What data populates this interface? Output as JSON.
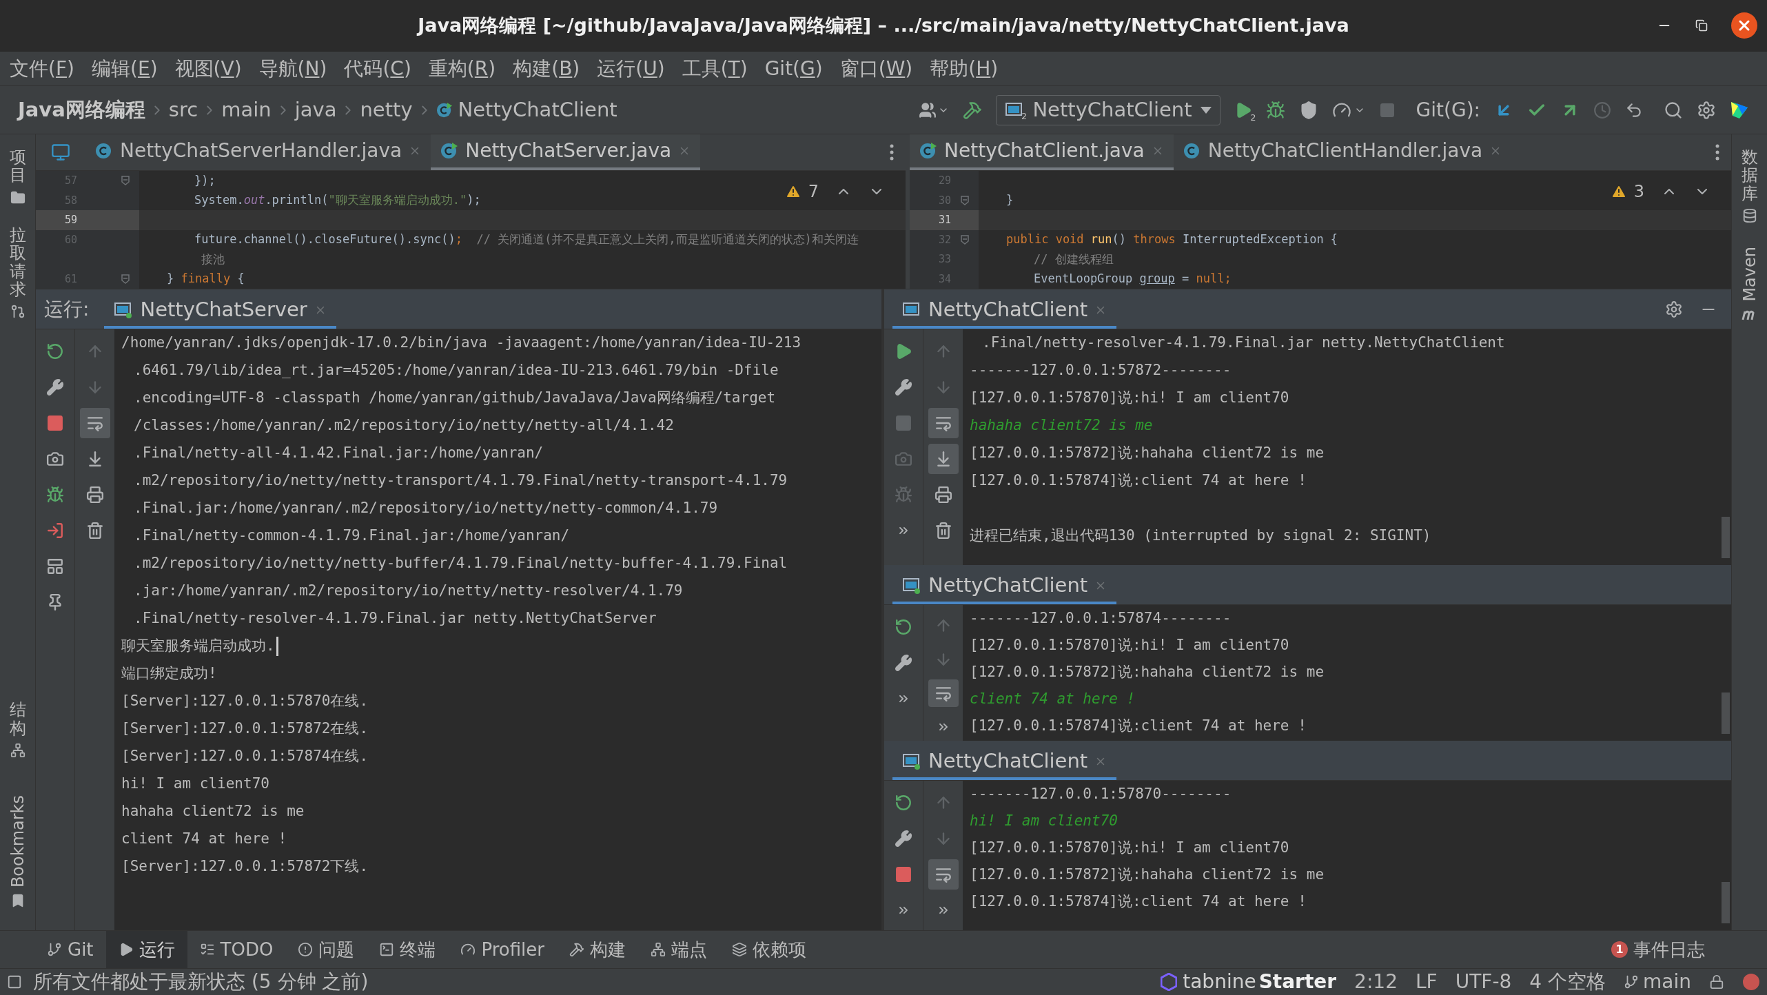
{
  "window": {
    "title": "Java网络编程 [~/github/JavaJava/Java网络编程] – .../src/main/java/netty/NettyChatClient.java"
  },
  "menu": [
    {
      "before": "文件(",
      "key": "F",
      "after": ")"
    },
    {
      "before": "编辑(",
      "key": "E",
      "after": ")"
    },
    {
      "before": "视图(",
      "key": "V",
      "after": ")"
    },
    {
      "before": "导航(",
      "key": "N",
      "after": ")"
    },
    {
      "before": "代码(",
      "key": "C",
      "after": ")"
    },
    {
      "before": "重构(",
      "key": "R",
      "after": ")"
    },
    {
      "before": "构建(",
      "key": "B",
      "after": ")"
    },
    {
      "before": "运行(",
      "key": "U",
      "after": ")"
    },
    {
      "before": "工具(",
      "key": "T",
      "after": ")"
    },
    {
      "before": "Git(",
      "key": "G",
      "after": ")"
    },
    {
      "before": "窗口(",
      "key": "W",
      "after": ")"
    },
    {
      "before": "帮助(",
      "key": "H",
      "after": ")"
    }
  ],
  "breadcrumbs": [
    {
      "label": "Java网络编程",
      "kind": "project"
    },
    {
      "label": "src",
      "kind": "folder"
    },
    {
      "label": "main",
      "kind": "folder"
    },
    {
      "label": "java",
      "kind": "folder"
    },
    {
      "label": "netty",
      "kind": "folder"
    },
    {
      "label": "NettyChatClient",
      "kind": "class"
    }
  ],
  "toolbar": {
    "run_config": "NettyChatClient",
    "config_badge": "2",
    "run_badge": "2",
    "git_label": "Git(G):"
  },
  "left_strip": {
    "top": [
      {
        "label": "项目",
        "kind": "project"
      },
      {
        "label": "拉取请求",
        "kind": "pull"
      }
    ],
    "bottom": [
      {
        "label": "结构",
        "kind": "structure"
      },
      {
        "label": "Bookmarks",
        "kind": "bookmarks"
      }
    ]
  },
  "right_strip": [
    {
      "label": "数据库",
      "kind": "database"
    },
    {
      "label": "Maven",
      "kind": "maven"
    }
  ],
  "editors": [
    {
      "tabs": [
        {
          "label": "NettyChatServerHandler.java",
          "selected": false,
          "runnable": false
        },
        {
          "label": "NettyChatServer.java",
          "selected": true,
          "runnable": true
        }
      ],
      "warnings": "7",
      "lines": [
        {
          "number": "57",
          "current": false,
          "fold": true,
          "kind": "inner",
          "segments": [
            {
              "text": "});",
              "kind": "plain"
            }
          ]
        },
        {
          "number": "58",
          "current": false,
          "fold": false,
          "kind": "inner",
          "segments": [
            {
              "text": "System.",
              "kind": "plain"
            },
            {
              "text": "out",
              "kind": "field"
            },
            {
              "text": ".println(",
              "kind": "plain"
            },
            {
              "text": "\"聊天室服务端启动成功.\"",
              "kind": "string"
            },
            {
              "text": ");",
              "kind": "plain"
            }
          ]
        },
        {
          "number": "59",
          "current": true,
          "fold": false
        },
        {
          "number": "60",
          "current": false,
          "fold": false,
          "kind": "inner",
          "segments": [
            {
              "text": "future.channel().closeFuture().sync()",
              "kind": "plain"
            },
            {
              "text": ";",
              "kind": "keyword"
            },
            {
              "text": "  // 关闭通道(并不是真正意义上关闭,而是监听通道关闭的状态)和关闭连",
              "kind": "comment"
            }
          ]
        },
        {
          "current": false,
          "fold": false,
          "kind": "wrapped",
          "segments": [
            {
              "text": "接池",
              "kind": "comment"
            }
          ]
        },
        {
          "number": "61",
          "current": false,
          "fold": true,
          "kind": "outer",
          "segments": [
            {
              "text": "} ",
              "kind": "plain"
            },
            {
              "text": "finally",
              "kind": "keyword"
            },
            {
              "text": " {",
              "kind": "plain"
            }
          ]
        }
      ]
    },
    {
      "tabs": [
        {
          "label": "NettyChatClient.java",
          "selected": true,
          "runnable": true
        },
        {
          "label": "NettyChatClientHandler.java",
          "selected": false,
          "runnable": false
        }
      ],
      "warnings": "3",
      "lines": [
        {
          "number": "29",
          "current": false,
          "fold": false
        },
        {
          "number": "30",
          "current": false,
          "fold": true,
          "kind": "outer",
          "segments": [
            {
              "text": "}",
              "kind": "plain"
            }
          ]
        },
        {
          "number": "31",
          "current": true,
          "fold": false
        },
        {
          "number": "32",
          "current": false,
          "fold": true,
          "kind": "outer",
          "segments": [
            {
              "text": "public void",
              "kind": "keyword"
            },
            {
              "text": " run",
              "kind": "method"
            },
            {
              "text": "() ",
              "kind": "plain"
            },
            {
              "text": "throws",
              "kind": "keyword"
            },
            {
              "text": " InterruptedException {",
              "kind": "plain"
            }
          ]
        },
        {
          "number": "33",
          "current": false,
          "fold": false,
          "kind": "inner",
          "segments": [
            {
              "text": "// 创建线程组",
              "kind": "comment"
            }
          ]
        },
        {
          "number": "34",
          "current": false,
          "fold": false,
          "kind": "inner",
          "segments": [
            {
              "text": "EventLoopGroup ",
              "kind": "plain"
            },
            {
              "text": "group",
              "kind": "underline"
            },
            {
              "text": " = ",
              "kind": "plain"
            },
            {
              "text": "null",
              "kind": "keyword"
            },
            {
              "text": ";",
              "kind": "keyword"
            }
          ]
        }
      ]
    }
  ],
  "run": {
    "label": "运行:",
    "panels": [
      {
        "title": "NettyChatServer",
        "running": true,
        "selected": true,
        "tools_a": [
          {
            "kind": "rerun",
            "disabled": false
          },
          {
            "kind": "wrench",
            "disabled": false
          },
          {
            "kind": "stop",
            "disabled": false
          },
          {
            "kind": "camera",
            "disabled": false
          },
          {
            "kind": "debug",
            "disabled": false
          },
          {
            "kind": "exit",
            "disabled": false
          },
          {
            "kind": "layout",
            "disabled": false
          },
          {
            "kind": "pin",
            "disabled": false
          }
        ],
        "tools_b": [
          {
            "kind": "up",
            "disabled": true,
            "selected": false
          },
          {
            "kind": "down",
            "disabled": true,
            "selected": false
          },
          {
            "kind": "wrap",
            "disabled": false,
            "selected": true
          },
          {
            "kind": "scroll-end",
            "disabled": false,
            "selected": false
          },
          {
            "kind": "print",
            "disabled": false,
            "selected": false
          },
          {
            "kind": "trash",
            "disabled": false,
            "selected": false
          }
        ],
        "lines": [
          {
            "kind": "output",
            "text": "/home/yanran/.jdks/openjdk-17.0.2/bin/java -javaagent:/home/yanran/idea-IU-213"
          },
          {
            "kind": "cont",
            "text": ".6461.79/lib/idea_rt.jar=45205:/home/yanran/idea-IU-213.6461.79/bin -Dfile"
          },
          {
            "kind": "cont",
            "text": ".encoding=UTF-8 -classpath /home/yanran/github/JavaJava/Java网络编程/target"
          },
          {
            "kind": "cont",
            "text": "/classes:/home/yanran/.m2/repository/io/netty/netty-all/4.1.42"
          },
          {
            "kind": "cont",
            "text": ".Final/netty-all-4.1.42.Final.jar:/home/yanran/"
          },
          {
            "kind": "cont",
            "text": ".m2/repository/io/netty/netty-transport/4.1.79.Final/netty-transport-4.1.79"
          },
          {
            "kind": "cont",
            "text": ".Final.jar:/home/yanran/.m2/repository/io/netty/netty-common/4.1.79"
          },
          {
            "kind": "cont",
            "text": ".Final/netty-common-4.1.79.Final.jar:/home/yanran/"
          },
          {
            "kind": "cont",
            "text": ".m2/repository/io/netty/netty-buffer/4.1.79.Final/netty-buffer-4.1.79.Final"
          },
          {
            "kind": "cont",
            "text": ".jar:/home/yanran/.m2/repository/io/netty/netty-resolver/4.1.79"
          },
          {
            "kind": "cont",
            "text": ".Final/netty-resolver-4.1.79.Final.jar netty.NettyChatServer"
          },
          {
            "kind": "caret",
            "text": "聊天室服务端启动成功."
          },
          {
            "kind": "output",
            "text": "端口绑定成功!"
          },
          {
            "kind": "output",
            "text": "[Server]:127.0.0.1:57870在线."
          },
          {
            "kind": "output",
            "text": "[Server]:127.0.0.1:57872在线."
          },
          {
            "kind": "output",
            "text": "[Server]:127.0.0.1:57874在线."
          },
          {
            "kind": "output",
            "text": "hi! I am client70"
          },
          {
            "kind": "output",
            "text": "hahaha client72 is me"
          },
          {
            "kind": "output",
            "text": "client 74 at here !"
          },
          {
            "kind": "output",
            "text": "[Server]:127.0.0.1:57872下线."
          }
        ]
      },
      {
        "title": "NettyChatClient",
        "running": false,
        "selected": true,
        "tools_a": [
          {
            "kind": "run",
            "disabled": false
          },
          {
            "kind": "wrench",
            "disabled": false
          },
          {
            "kind": "stop",
            "disabled": true
          },
          {
            "kind": "camera",
            "disabled": true
          },
          {
            "kind": "debug",
            "disabled": true
          },
          {
            "kind": "more",
            "disabled": false
          }
        ],
        "tools_b": [
          {
            "kind": "up",
            "disabled": true,
            "selected": false
          },
          {
            "kind": "down",
            "disabled": true,
            "selected": false
          },
          {
            "kind": "wrap",
            "disabled": false,
            "selected": true
          },
          {
            "kind": "scroll-end",
            "disabled": false,
            "selected": true
          },
          {
            "kind": "print",
            "disabled": false,
            "selected": false
          },
          {
            "kind": "trash",
            "disabled": false,
            "selected": false
          }
        ],
        "lines": [
          {
            "kind": "cont",
            "text": ".Final/netty-resolver-4.1.79.Final.jar netty.NettyChatClient"
          },
          {
            "kind": "output",
            "text": "-------127.0.0.1:57872--------"
          },
          {
            "kind": "output",
            "text": "[127.0.0.1:57870]说:hi! I am client70"
          },
          {
            "kind": "input",
            "text": "hahaha client72 is me"
          },
          {
            "kind": "output",
            "text": "[127.0.0.1:57872]说:hahaha client72 is me"
          },
          {
            "kind": "output",
            "text": "[127.0.0.1:57874]说:client 74 at here !"
          },
          {
            "kind": "blank"
          },
          {
            "kind": "output",
            "text": "进程已结束,退出代码130 (interrupted by signal 2: SIGINT)"
          }
        ]
      },
      {
        "title": "NettyChatClient",
        "running": true,
        "selected": true,
        "tools_a": [
          {
            "kind": "rerun",
            "disabled": false
          },
          {
            "kind": "wrench",
            "disabled": false
          },
          {
            "kind": "more",
            "disabled": false
          }
        ],
        "tools_b": [
          {
            "kind": "up",
            "disabled": true,
            "selected": false
          },
          {
            "kind": "down",
            "disabled": true,
            "selected": false
          },
          {
            "kind": "wrap",
            "disabled": false,
            "selected": true
          },
          {
            "kind": "more",
            "disabled": false,
            "selected": false
          }
        ],
        "lines": [
          {
            "kind": "output",
            "text": "-------127.0.0.1:57874--------"
          },
          {
            "kind": "output",
            "text": "[127.0.0.1:57870]说:hi! I am client70"
          },
          {
            "kind": "output",
            "text": "[127.0.0.1:57872]说:hahaha client72 is me"
          },
          {
            "kind": "input",
            "text": "client 74 at here !"
          },
          {
            "kind": "output",
            "text": "[127.0.0.1:57874]说:client 74 at here !"
          }
        ]
      },
      {
        "title": "NettyChatClient",
        "running": true,
        "selected": true,
        "tools_a": [
          {
            "kind": "rerun",
            "disabled": false
          },
          {
            "kind": "wrench",
            "disabled": false
          },
          {
            "kind": "stop",
            "disabled": false
          },
          {
            "kind": "more",
            "disabled": false
          }
        ],
        "tools_b": [
          {
            "kind": "up",
            "disabled": true,
            "selected": false
          },
          {
            "kind": "down",
            "disabled": true,
            "selected": false
          },
          {
            "kind": "wrap",
            "disabled": false,
            "selected": true
          },
          {
            "kind": "more",
            "disabled": false,
            "selected": false
          }
        ],
        "lines": [
          {
            "kind": "output",
            "text": "-------127.0.0.1:57870--------"
          },
          {
            "kind": "input",
            "text": "hi! I am client70"
          },
          {
            "kind": "output",
            "text": "[127.0.0.1:57870]说:hi! I am client70"
          },
          {
            "kind": "output",
            "text": "[127.0.0.1:57872]说:hahaha client72 is me"
          },
          {
            "kind": "output",
            "text": "[127.0.0.1:57874]说:client 74 at here !"
          }
        ]
      }
    ]
  },
  "bottom_tools": [
    {
      "label": "Git",
      "kind": "git",
      "selected": false
    },
    {
      "label": "运行",
      "kind": "run",
      "selected": true
    },
    {
      "label": "TODO",
      "kind": "todo",
      "selected": false
    },
    {
      "label": "问题",
      "kind": "problems",
      "selected": false
    },
    {
      "label": "终端",
      "kind": "terminal",
      "selected": false
    },
    {
      "label": "Profiler",
      "kind": "profiler",
      "selected": false
    },
    {
      "label": "构建",
      "kind": "build",
      "selected": false
    },
    {
      "label": "端点",
      "kind": "endpoints",
      "selected": false
    },
    {
      "label": "依赖项",
      "kind": "dependencies",
      "selected": false
    }
  ],
  "event_log": {
    "count": "1",
    "label": "事件日志"
  },
  "status_bar": {
    "message": "所有文件都处于最新状态 (5 分钟 之前)",
    "tabnine": "tabnine",
    "tabnine_plan": "Starter",
    "position": "2:12",
    "line_ending": "LF",
    "encoding": "UTF-8",
    "indent": "4 个空格",
    "branch": "main"
  }
}
